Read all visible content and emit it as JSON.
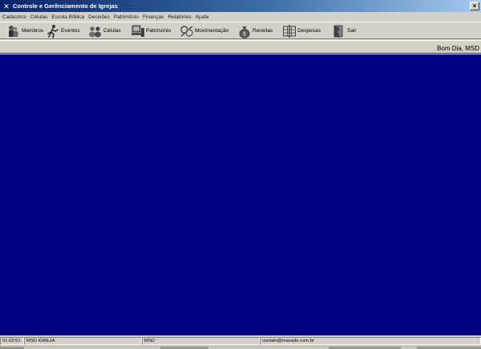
{
  "window": {
    "title": "Controle e Gerênciamento de Igrejas",
    "close_label": "×"
  },
  "menu": [
    "Cadastros",
    "Células",
    "Escola Bíblica",
    "Decisões",
    "Patrimônio",
    "Finanças",
    "Relatórios",
    "Ajuda"
  ],
  "toolbar": {
    "membros": "Membros",
    "eventos": "Eventos",
    "celulas": "Células",
    "patrimonio": "Patrimonio",
    "movimentacao": "Movimentação",
    "receitas": "Receitas",
    "despesas": "Despesas",
    "sair": "Sair"
  },
  "greeting": "Bom Dia, MSD",
  "colors": {
    "workspace": "#000080",
    "window_face": "#d4d0c8"
  },
  "status": {
    "time": "01:10:51",
    "church": "MSD IGREJA",
    "user": "MSD",
    "contact": "contato@masade.com.br"
  }
}
